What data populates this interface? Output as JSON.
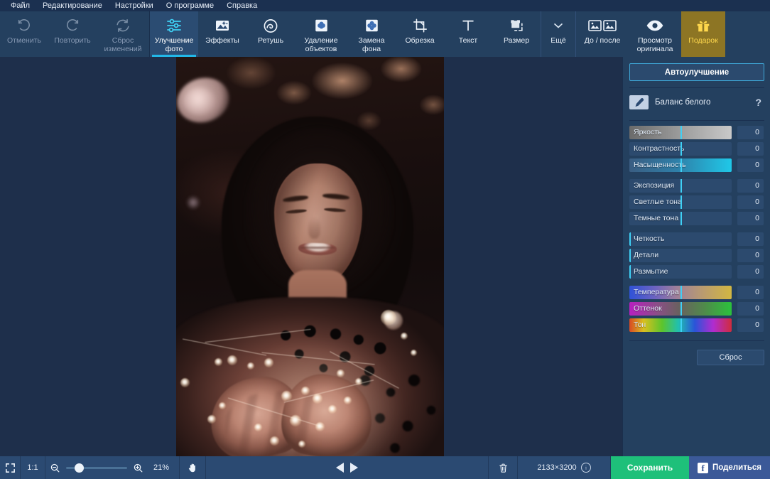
{
  "menu": {
    "items": [
      {
        "label": "Файл",
        "name": "menu-file"
      },
      {
        "label": "Редактирование",
        "name": "menu-edit"
      },
      {
        "label": "Настройки",
        "name": "menu-settings"
      },
      {
        "label": "О программе",
        "name": "menu-about"
      },
      {
        "label": "Справка",
        "name": "menu-help"
      }
    ]
  },
  "toolbar": {
    "undo": {
      "label": "Отменить",
      "icon": "undo-arrow-icon",
      "disabled": true
    },
    "redo": {
      "label": "Повторить",
      "icon": "redo-arrow-icon",
      "disabled": true
    },
    "reset": {
      "label": "Сброс\nизменений",
      "icon": "reset-circular-icon",
      "disabled": true
    },
    "adjust": {
      "label": "Улучшение\nфото",
      "icon": "sliders-icon",
      "active": true
    },
    "effects": {
      "label": "Эффекты",
      "icon": "magic-photo-icon"
    },
    "retouch": {
      "label": "Ретушь",
      "icon": "retouch-face-icon"
    },
    "object_removal": {
      "label": "Удаление\nобъектов",
      "icon": "object-remove-icon"
    },
    "background": {
      "label": "Замена\nфона",
      "icon": "background-swap-icon"
    },
    "crop": {
      "label": "Обрезка",
      "icon": "crop-icon"
    },
    "text": {
      "label": "Текст",
      "icon": "text-t-icon"
    },
    "resize": {
      "label": "Размер",
      "icon": "resize-icon"
    },
    "more": {
      "label": "Ещё",
      "icon": "chevron-down-icon"
    },
    "before_after": {
      "label": "До / после",
      "icon": "before-after-icon"
    },
    "view_original": {
      "label": "Просмотр\nоригинала",
      "icon": "eye-icon"
    },
    "gift": {
      "label": "Подарок",
      "icon": "gift-icon",
      "bg": "#8d7524",
      "fg": "#ffd84d"
    }
  },
  "panel": {
    "auto_enhance_label": "Автоулучшение",
    "white_balance": {
      "label": "Баланс белого",
      "icon": "eyedropper-icon",
      "help": "?"
    },
    "reset_label": "Сброс",
    "groups": [
      {
        "sliders": [
          {
            "label": "Яркость",
            "value": "0",
            "knob_pct": 50,
            "track": "brightness"
          },
          {
            "label": "Контрастность",
            "value": "0",
            "knob_pct": 50,
            "track": "plain"
          },
          {
            "label": "Насыщенность",
            "value": "0",
            "knob_pct": 50,
            "track": "saturation"
          }
        ]
      },
      {
        "sliders": [
          {
            "label": "Экспозиция",
            "value": "0",
            "knob_pct": 50,
            "track": "plain"
          },
          {
            "label": "Светлые тона",
            "value": "0",
            "knob_pct": 50,
            "track": "plain"
          },
          {
            "label": "Темные тона",
            "value": "0",
            "knob_pct": 50,
            "track": "plain"
          }
        ]
      },
      {
        "sliders": [
          {
            "label": "Четкость",
            "value": "0",
            "knob_pct": 0,
            "track": "plain"
          },
          {
            "label": "Детали",
            "value": "0",
            "knob_pct": 0,
            "track": "plain"
          },
          {
            "label": "Размытие",
            "value": "0",
            "knob_pct": 0,
            "track": "plain"
          }
        ]
      },
      {
        "sliders": [
          {
            "label": "Температура",
            "value": "0",
            "knob_pct": 50,
            "track": "temperature"
          },
          {
            "label": "Оттенок",
            "value": "0",
            "knob_pct": 50,
            "track": "tint"
          },
          {
            "label": "Тон",
            "value": "0",
            "knob_pct": 50,
            "track": "hue"
          }
        ]
      }
    ]
  },
  "statusbar": {
    "fit_icon": "fit-to-screen-icon",
    "one_to_one": "1:1",
    "zoom_out_icon": "zoom-out-icon",
    "zoom_in_icon": "zoom-in-icon",
    "zoom_level": "21%",
    "zoom_knob_pct": 16,
    "hand_icon": "hand-tool-icon",
    "prev_icon": "previous-arrow-icon",
    "next_icon": "next-arrow-icon",
    "delete_icon": "trash-icon",
    "dimensions": "2133×3200",
    "info_icon": "info-icon",
    "save_label": "Сохранить",
    "share_label": "Поделиться",
    "share_icon": "facebook-icon"
  },
  "colors": {
    "accent": "#22b8e8",
    "menu_bg": "#1b3050",
    "toolbar_bg": "#24405f",
    "canvas_bg": "#1e2f4b",
    "bottom_bg": "#2b4a72",
    "save_green": "#1ec07a",
    "facebook_blue": "#3b5998",
    "gift_bg": "#8d7524"
  }
}
